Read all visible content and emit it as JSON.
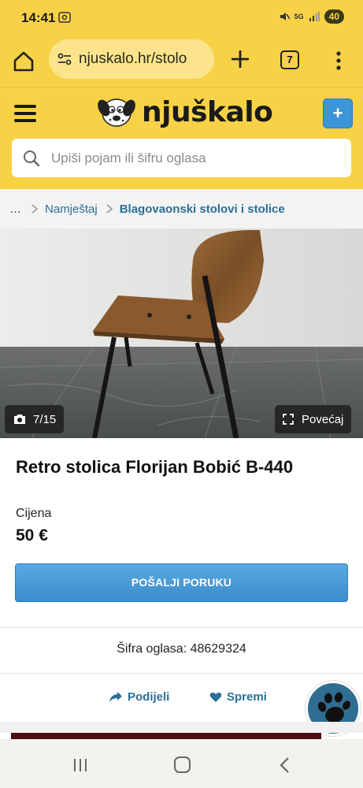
{
  "status_bar": {
    "time": "14:41",
    "battery": "40",
    "network": "5G"
  },
  "browser": {
    "url": "njuskalo.hr/stolo",
    "tab_count": "7"
  },
  "site": {
    "logo_text": "njuškalo",
    "add_button": "+",
    "search_placeholder": "Upiši pojam ili šifru oglasa"
  },
  "breadcrumb": {
    "ellipsis": "…",
    "items": [
      "Namještaj",
      "Blagovaonski stolovi i stolice"
    ]
  },
  "gallery": {
    "counter": "7/15",
    "zoom_label": "Povećaj"
  },
  "ad": {
    "title": "Retro stolica Florijan Bobić B-440",
    "price_label": "Cijena",
    "price": "50 €",
    "send_message": "POŠALJI PORUKU",
    "ad_code": "Šifra oglasa: 48629324",
    "share": "Podijeli",
    "save": "Spremi"
  },
  "colors": {
    "brand_yellow": "#f8d246",
    "accent_blue": "#3b95d6",
    "link_blue": "#2a6f97"
  }
}
